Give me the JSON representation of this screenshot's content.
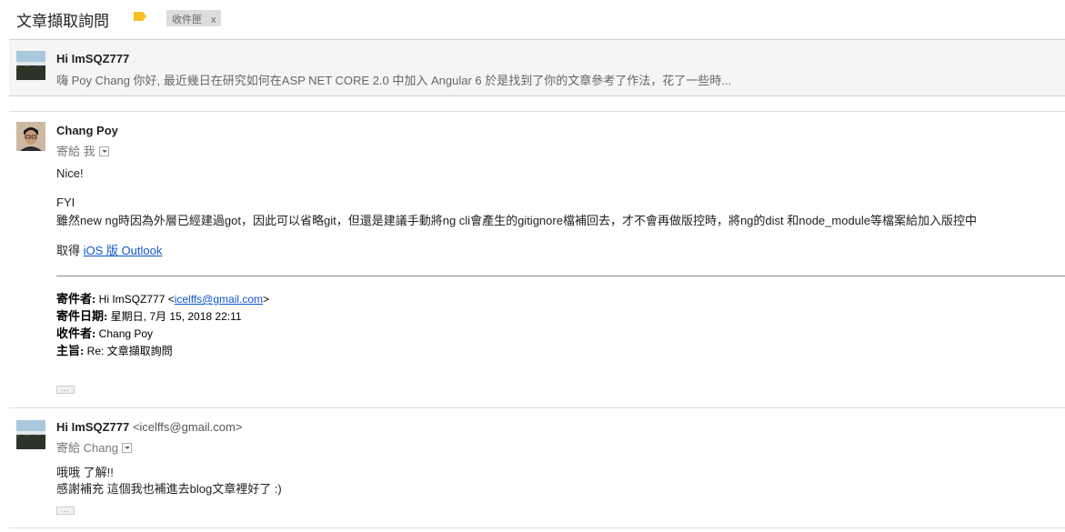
{
  "thread": {
    "subject": "文章擷取詢問",
    "label_color": "#f6c026",
    "inbox_chip": {
      "label": "收件匣",
      "close": "x"
    }
  },
  "messages": [
    {
      "sender": "Hi ImSQZ777",
      "snippet": "嗨 Poy Chang 你好, 最近幾日在研究如何在ASP NET CORE 2.0 中加入 Angular 6 於是找到了你的文章參考了作法，花了一些時..."
    },
    {
      "sender": "Chang Poy",
      "to": "寄給 我",
      "body": {
        "line1": "Nice!",
        "line2": "FYI",
        "line3": "雖然new ng時因為外層已經建過got，因此可以省略git，但還是建議手動將ng cli會產生的gitignore檔補回去，才不會再做版控時，將ng的dist 和node_module等檔案給加入版控中",
        "get_prefix": "取得 ",
        "get_link": "iOS 版 Outlook"
      },
      "quoted": {
        "from_label": "寄件者:",
        "from_name": " Hi ImSQZ777 <",
        "from_email": "icelffs@gmail.com",
        "from_close": ">",
        "date_label": "寄件日期:",
        "date_value": " 星期日, 7月 15, 2018 22:11",
        "to_label": "收件者:",
        "to_value": " Chang Poy",
        "subject_label": "主旨:",
        "subject_value": " Re: 文章擷取詢問"
      },
      "ellipsis": "..."
    },
    {
      "sender": "Hi ImSQZ777",
      "sender_email": "<icelffs@gmail.com>",
      "to": "寄給 Chang",
      "body": {
        "line1": "哦哦 了解!!",
        "line2": "感謝補充 這個我也補進去blog文章裡好了 :)"
      },
      "ellipsis": "..."
    }
  ]
}
